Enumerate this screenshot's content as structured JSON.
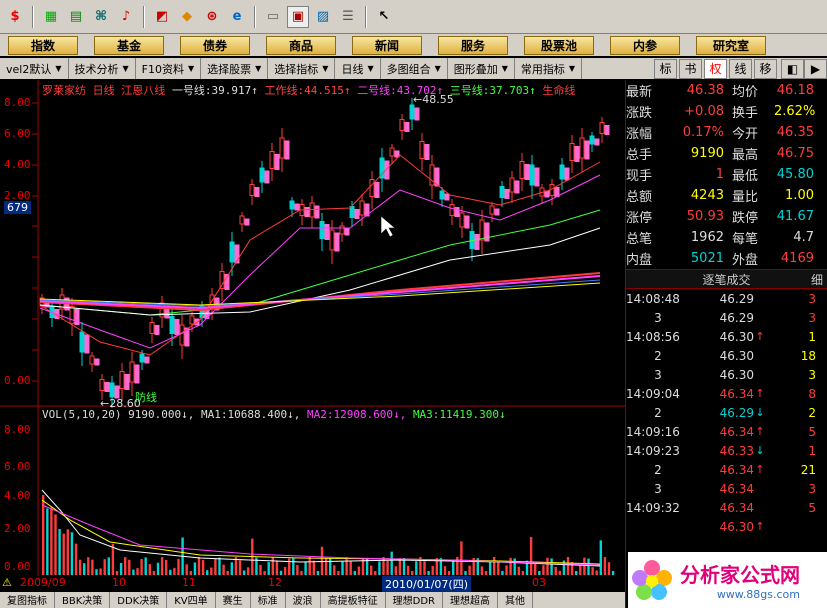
{
  "toolbar_icons": [
    "dollar-icon",
    "board-icon",
    "grid-icon",
    "binoculars-icon",
    "bell-icon",
    "chart-icon",
    "diamond-icon",
    "search-globe-icon",
    "e-icon",
    "doc-icon",
    "window-icon",
    "photo-icon",
    "news-icon",
    "pointer-icon"
  ],
  "menu": [
    "指数",
    "基金",
    "债券",
    "商品",
    "新闻",
    "服务",
    "股票池",
    "内参",
    "研究室"
  ],
  "tabs": {
    "left": [
      "vel2默认",
      "技术分析",
      "F10资料",
      "选择股票",
      "选择指标",
      "日线",
      "多图组合",
      "图形叠加",
      "常用指标"
    ],
    "right": [
      "标",
      "书",
      "权",
      "线",
      "移"
    ]
  },
  "chart": {
    "name": "罗莱家纺",
    "period": "日线",
    "indicator_name": "江恩八线",
    "line1_label": "一号线:",
    "line1_val": "39.917",
    "line2_label": "工作线:",
    "line2_val": "44.515",
    "line3_label": "二号线:",
    "line3_val": "43.702",
    "line4_label": "三号线:",
    "line4_val": "37.703",
    "line5_label": "生命线",
    "high_mark": "←48.55",
    "low_mark": "←28.60",
    "low_label": "防线",
    "current_marker": "679",
    "yticks": [
      "8.00",
      "6.00",
      "4.00",
      "2.00",
      "0.00",
      "8.00",
      "6.00",
      "4.00",
      "2.00",
      "0.00"
    ],
    "vol_label": "VOL(5,10,20)",
    "vol_val": "9190.000",
    "ma1_label": "MA1:",
    "ma1_val": "10688.400",
    "ma2_label": "MA2:",
    "ma2_val": "12908.600",
    "ma3_label": "MA3:",
    "ma3_val": "11419.300",
    "vol_ticks": [
      "0000",
      "0000",
      "0000",
      "0000",
      "0000",
      "0000",
      "X10"
    ],
    "dates": [
      "2009/09",
      "10",
      "11",
      "12",
      "2010/01/07(四)",
      "03"
    ],
    "bottom_tabs": [
      "复图指标",
      "BBK决策",
      "DDK决策",
      "KV四单",
      "赛生",
      "标准",
      "波浪",
      "高提板特征",
      "理想DDR",
      "理想超高",
      "其他"
    ]
  },
  "quote": [
    {
      "k": "最新",
      "v": "46.38",
      "vc": "red",
      "k2": "均价",
      "v2": "46.18",
      "v2c": "red"
    },
    {
      "k": "涨跌",
      "v": "+0.08",
      "vc": "red",
      "k2": "换手",
      "v2": "2.62%",
      "v2c": "yel"
    },
    {
      "k": "涨幅",
      "v": "0.17%",
      "vc": "red",
      "k2": "今开",
      "v2": "46.35",
      "v2c": "red"
    },
    {
      "k": "总手",
      "v": "9190",
      "vc": "yel",
      "k2": "最高",
      "v2": "46.75",
      "v2c": "red"
    },
    {
      "k": "现手",
      "v": "1",
      "vc": "red",
      "k2": "最低",
      "v2": "45.80",
      "v2c": "grn"
    },
    {
      "k": "总额",
      "v": "4243",
      "vc": "yel",
      "k2": "量比",
      "v2": "1.00",
      "v2c": "yel"
    },
    {
      "k": "涨停",
      "v": "50.93",
      "vc": "red",
      "k2": "跌停",
      "v2": "41.67",
      "v2c": "grn"
    },
    {
      "k": "总笔",
      "v": "1962",
      "vc": "wht",
      "k2": "每笔",
      "v2": "4.7",
      "v2c": "wht"
    },
    {
      "k": "内盘",
      "v": "5021",
      "vc": "grn",
      "k2": "外盘",
      "v2": "4169",
      "v2c": "red"
    }
  ],
  "ticks_header": "逐笔成交",
  "ticks_header_right": "细",
  "ticks": [
    {
      "t": "14:08:48",
      "p": "46.29",
      "pc": "wht",
      "a": "",
      "q": "3",
      "qc": "red"
    },
    {
      "t": "",
      "p": "46.29",
      "pc": "wht",
      "a": "",
      "q": "3",
      "qc": "red"
    },
    {
      "t": "14:08:56",
      "p": "46.30",
      "pc": "wht",
      "a": "↑",
      "q": "1",
      "qc": "yel"
    },
    {
      "t": "",
      "p": "46.30",
      "pc": "wht",
      "a": "",
      "q": "18",
      "qc": "yel"
    },
    {
      "t": "",
      "p": "46.30",
      "pc": "wht",
      "a": "",
      "q": "3",
      "qc": "yel"
    },
    {
      "t": "14:09:04",
      "p": "46.34",
      "pc": "red",
      "a": "↑",
      "q": "8",
      "qc": "red"
    },
    {
      "t": "",
      "p": "46.29",
      "pc": "grn",
      "a": "↓",
      "q": "2",
      "qc": "yel"
    },
    {
      "t": "14:09:16",
      "p": "46.34",
      "pc": "red",
      "a": "↑",
      "q": "5",
      "qc": "red"
    },
    {
      "t": "14:09:23",
      "p": "46.33",
      "pc": "red",
      "a": "↓",
      "q": "1",
      "qc": "red"
    },
    {
      "t": "",
      "p": "46.34",
      "pc": "red",
      "a": "↑",
      "q": "21",
      "qc": "yel"
    },
    {
      "t": "",
      "p": "46.34",
      "pc": "red",
      "a": "",
      "q": "3",
      "qc": "red"
    },
    {
      "t": "14:09:32",
      "p": "46.34",
      "pc": "red",
      "a": "",
      "q": "5",
      "qc": "red"
    },
    {
      "t": "",
      "p": "46.30",
      "pc": "red",
      "a": "↑",
      "q": "",
      "qc": "red"
    }
  ],
  "ticks_left_nums": [
    "3",
    "2",
    "3",
    "2",
    "2",
    "3"
  ],
  "logo_text": "分析家公式网",
  "logo_url": "www.88gs.com"
}
